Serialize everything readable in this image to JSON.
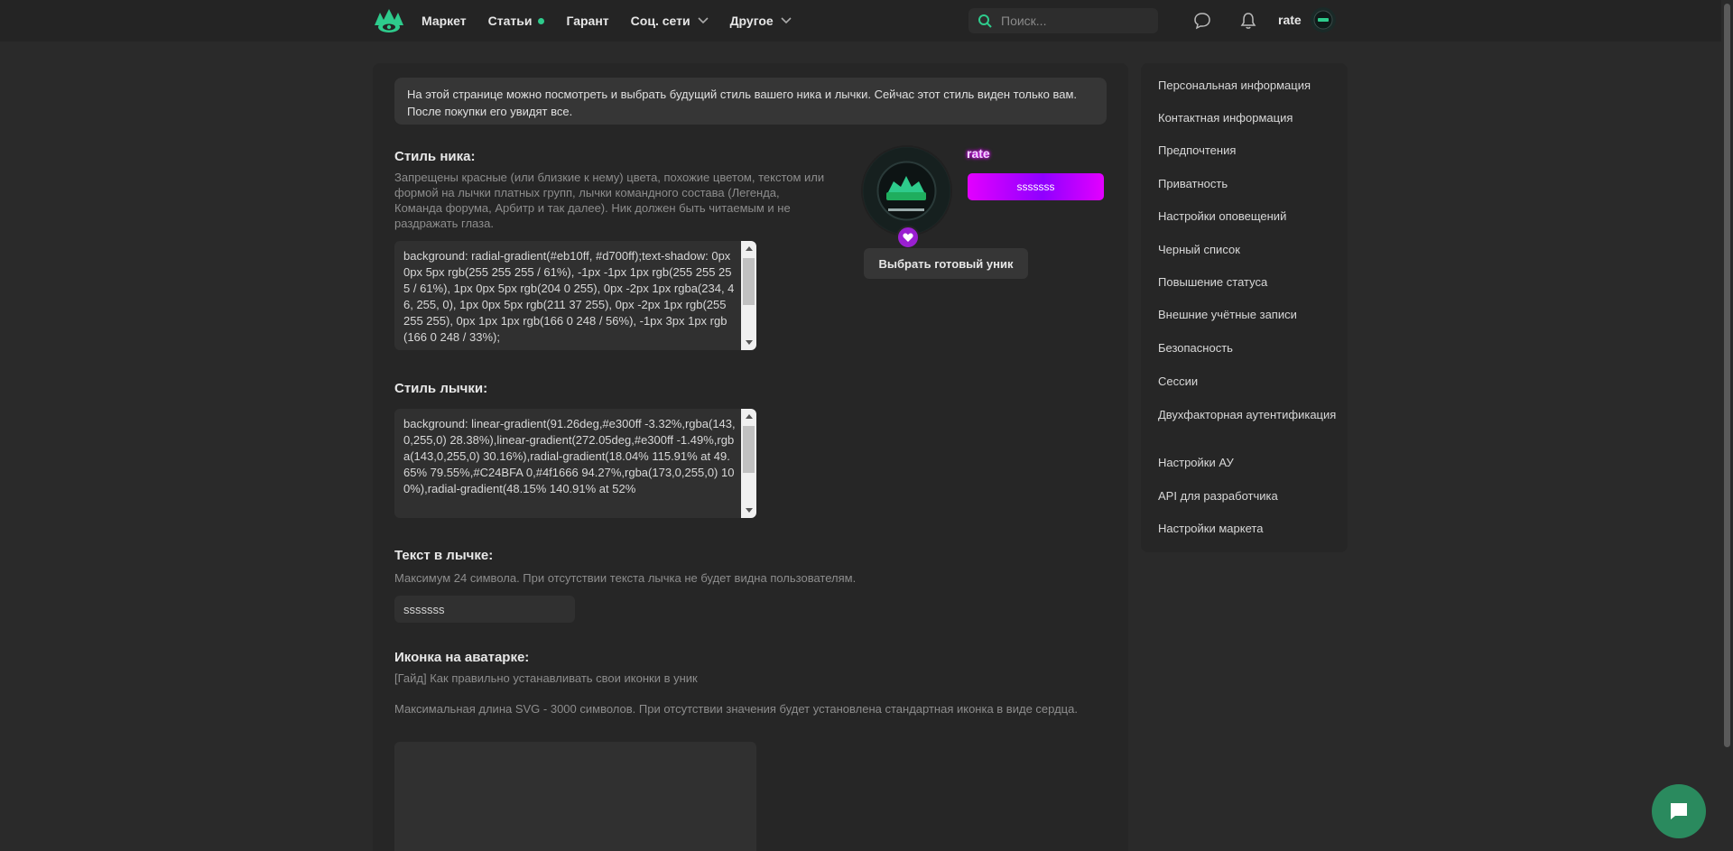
{
  "header": {
    "nav": [
      {
        "label": "Маркет"
      },
      {
        "label": "Статьи"
      },
      {
        "label": "Гарант"
      },
      {
        "label": "Соц. сети"
      },
      {
        "label": "Другое"
      }
    ],
    "search_placeholder": "Поиск...",
    "username": "rate",
    "accent_color": "#2ecb8c"
  },
  "notice": "На этой странице можно посмотреть и выбрать будущий стиль вашего ника и лычки. Сейчас этот стиль виден только вам. После покупки его увидят все.",
  "nick_style": {
    "title": "Стиль ника:",
    "desc": "Запрещены красные (или близкие к нему) цвета, похожие цветом, текстом или формой на лычки платных групп, лычки командного состава (Легенда, Команда форума, Арбитр и так далее). Ник должен быть читаемым и не раздражать глаза.",
    "value": "background: radial-gradient(#eb10ff, #d700ff);text-shadow: 0px 0px 5px rgb(255 255 255 / 61%), -1px -1px 1px rgb(255 255 255 / 61%), 1px 0px 5px rgb(204 0 255), 0px -2px 1px rgba(234, 46, 255, 0), 1px 0px 5px rgb(211 37 255), 0px -2px 1px rgb(255 255 255), 0px 1px 1px rgb(166 0 248 / 56%), -1px 3px 1px rgb(166 0 248 / 33%);"
  },
  "badge_style": {
    "title": "Стиль лычки:",
    "value": "background: linear-gradient(91.26deg,#e300ff -3.32%,rgba(143,0,255,0) 28.38%),linear-gradient(272.05deg,#e300ff -1.49%,rgba(143,0,255,0) 30.16%),radial-gradient(18.04% 115.91% at 49.65% 79.55%,#C24BFA 0,#4f1666 94.27%,rgba(173,0,255,0) 100%),radial-gradient(48.15% 140.91% at 52%"
  },
  "badge_text": {
    "title": "Текст в лычке:",
    "desc": "Максимум 24 символа. При отсутствии текста лычка не будет видна пользователям.",
    "value": "sssssss"
  },
  "avatar_icon": {
    "title": "Иконка на аватарке:",
    "guide_link": "[Гайд] Как правильно устанавливать свои иконки в уник",
    "desc": "Максимальная длина SVG - 3000 символов. При отсутствии значения будет установлена стандартная иконка в виде сердца."
  },
  "preview": {
    "nick": "rate",
    "badge": "sssssss",
    "button": "Выбрать готовый уник"
  },
  "sidebar": [
    {
      "label": "Персональная информация"
    },
    {
      "label": "Контактная информация"
    },
    {
      "label": "Предпочтения"
    },
    {
      "label": "Приватность"
    },
    {
      "label": "Настройки оповещений"
    },
    {
      "label": "Черный список"
    },
    {
      "label": "Повышение статуса"
    },
    {
      "label": "Внешние учётные записи"
    },
    {
      "label": "Безопасность"
    },
    {
      "label": "Сессии"
    },
    {
      "label": "Двухфакторная аутентификация"
    },
    {
      "label": "Настройки АУ"
    },
    {
      "label": "API для разработчика"
    },
    {
      "label": "Настройки маркета"
    }
  ],
  "icons": [
    "logo-icon",
    "chevron-down-icon",
    "search-icon",
    "chat-bubble-icon",
    "bell-icon",
    "heart-icon",
    "chat-icon"
  ]
}
